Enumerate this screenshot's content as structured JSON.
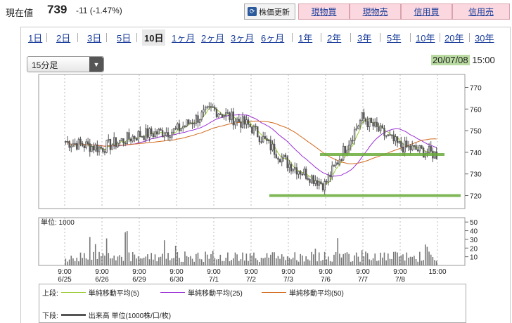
{
  "header": {
    "price_label": "現在値",
    "price_value": "739",
    "price_change": "-11 (-1.47%)",
    "refresh_label": "株価更新",
    "buttons": [
      "現物買",
      "現物売",
      "信用買",
      "信用売"
    ]
  },
  "tabs": [
    "1日",
    "2日",
    "3日",
    "5日",
    "10日",
    "1ヶ月",
    "2ヶ月",
    "3ヶ月",
    "6ヶ月",
    "1年",
    "2年",
    "3年",
    "5年",
    "10年",
    "20年",
    "30年"
  ],
  "active_tab": "10日",
  "interval_select": "15分足",
  "datetime": {
    "date": "20/07/08",
    "time": "15:00"
  },
  "volume_panel_label": "単位: 1000",
  "legend": {
    "upper_label": "上段:",
    "lower_label": "下段:",
    "ma5": "単純移動平均(5)",
    "ma25": "単純移動平均(25)",
    "ma50": "単純移動平均(50)",
    "volume": "出来高 単位(1000株/口/枚)"
  },
  "colors": {
    "ma5": "#9acd32",
    "ma25": "#9b30d6",
    "ma50": "#d2691e",
    "candle": "#555555",
    "bar": "#777777",
    "support": "#6aaa3a"
  },
  "chart_data": {
    "type": "candlestick",
    "price_axis": {
      "ticks": [
        770,
        760,
        750,
        740,
        730,
        720
      ],
      "ylim": [
        714,
        776
      ]
    },
    "volume_axis": {
      "ticks": [
        50,
        40,
        30,
        20,
        10
      ],
      "ylim": [
        0,
        55
      ]
    },
    "x_labels": [
      {
        "time": "9:00",
        "date": "6/25"
      },
      {
        "time": "9:00",
        "date": "6/26"
      },
      {
        "time": "9:00",
        "date": "6/29"
      },
      {
        "time": "9:00",
        "date": "6/30"
      },
      {
        "time": "9:00",
        "date": "7/1"
      },
      {
        "time": "9:00",
        "date": "7/2"
      },
      {
        "time": "9:00",
        "date": "7/3"
      },
      {
        "time": "9:00",
        "date": "7/6"
      },
      {
        "time": "9:00",
        "date": "7/7"
      },
      {
        "time": "9:00",
        "date": "7/8"
      },
      {
        "time": "15:00",
        "date": ""
      }
    ],
    "daily_close_approx": [
      {
        "date": "6/25",
        "close": 742
      },
      {
        "date": "6/26",
        "close": 748
      },
      {
        "date": "6/29",
        "close": 750
      },
      {
        "date": "6/30",
        "close": 760
      },
      {
        "date": "7/1",
        "close": 752
      },
      {
        "date": "7/2",
        "close": 735
      },
      {
        "date": "7/3",
        "close": 725
      },
      {
        "date": "7/6",
        "close": 756
      },
      {
        "date": "7/7",
        "close": 743
      },
      {
        "date": "7/8",
        "close": 739
      }
    ],
    "support_lines": [
      739,
      720
    ]
  }
}
